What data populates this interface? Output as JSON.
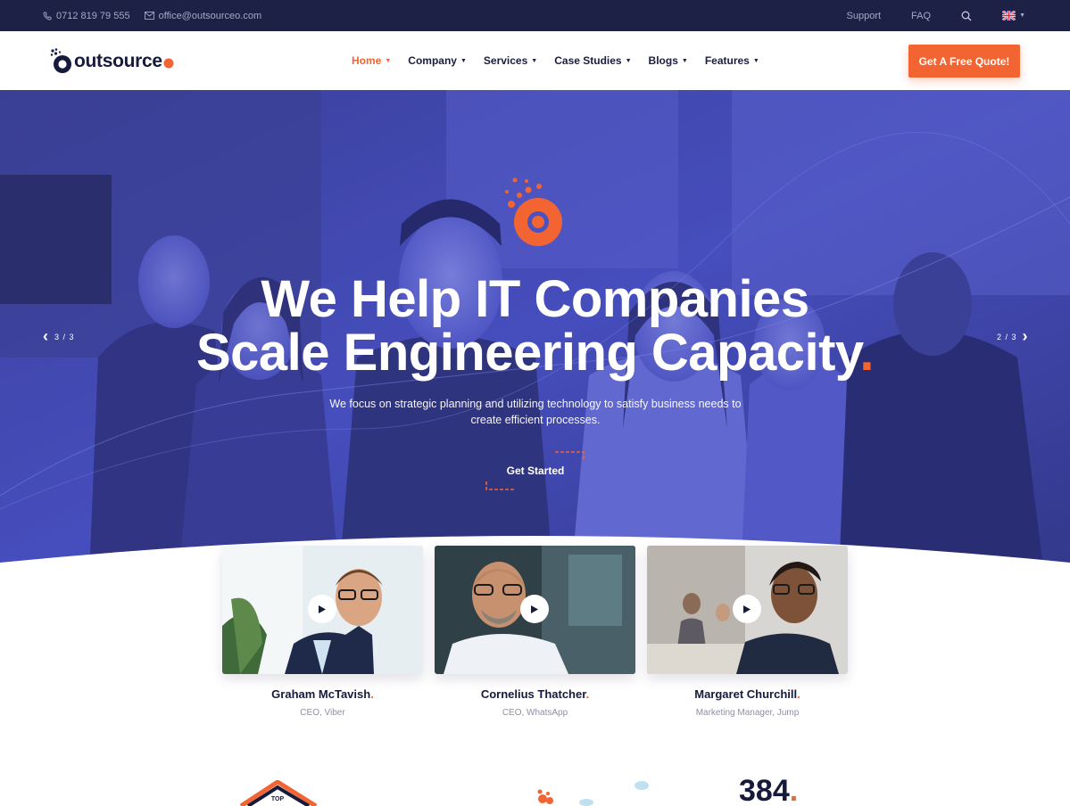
{
  "topbar": {
    "phone": "0712 819 79 555",
    "email": "office@outsourceo.com",
    "support": "Support",
    "faq": "FAQ",
    "language_icon": "uk-flag-icon"
  },
  "header": {
    "logo_text": "outsource",
    "nav": [
      {
        "label": "Home",
        "active": true
      },
      {
        "label": "Company"
      },
      {
        "label": "Services"
      },
      {
        "label": "Case Studies"
      },
      {
        "label": "Blogs"
      },
      {
        "label": "Features"
      }
    ],
    "cta": "Get A Free Quote!"
  },
  "hero": {
    "title_line1": "We Help IT Companies",
    "title_line2": "Scale Engineering Capacity",
    "title_dot": ".",
    "subtitle": "We focus on strategic planning and utilizing technology to satisfy business needs to create efficient processes.",
    "button": "Get Started",
    "prev_counter": "3 / 3",
    "next_counter": "2 / 3"
  },
  "people": [
    {
      "name": "Graham McTavish",
      "role": "CEO, Viber"
    },
    {
      "name": "Cornelius Thatcher",
      "role": "CEO, WhatsApp"
    },
    {
      "name": "Margaret Churchill",
      "role": "Marketing Manager, Jump"
    }
  ],
  "bottom": {
    "badge_text": "TOP",
    "stat": "384"
  },
  "colors": {
    "accent": "#f26533",
    "dark": "#1d2145",
    "hero_blue": "#4b53c4"
  }
}
